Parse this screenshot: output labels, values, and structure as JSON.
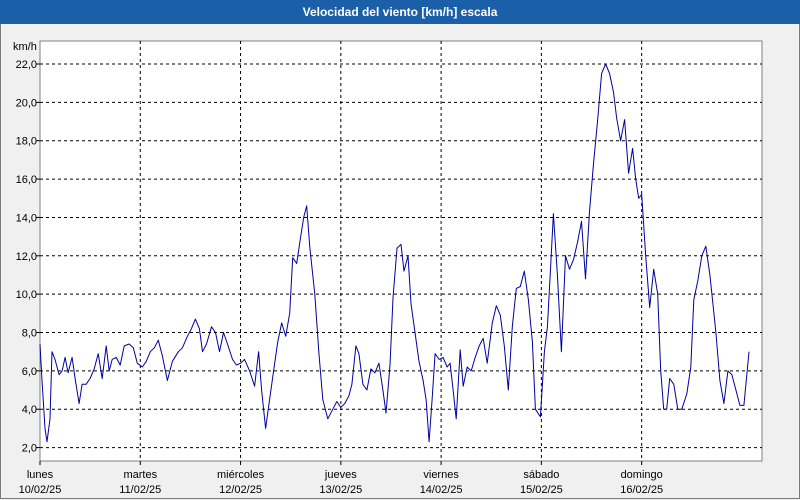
{
  "window": {
    "title": "Velocidad del viento [km/h] escala"
  },
  "colors": {
    "titlebar": "#1a5fa8",
    "line": "#0000a0",
    "plot_bg": "#ffffff",
    "background": "#f0f0f0"
  },
  "chart_data": {
    "type": "line",
    "title": "Velocidad del viento [km/h] escala",
    "ylabel": "km/h",
    "ylim": [
      1.3,
      23.2
    ],
    "yticks": [
      "2,0",
      "4,0",
      "6,0",
      "8,0",
      "10,0",
      "12,0",
      "14,0",
      "16,0",
      "18,0",
      "20,0",
      "22,0"
    ],
    "ytick_values": [
      2,
      4,
      6,
      8,
      10,
      12,
      14,
      16,
      18,
      20,
      22
    ],
    "x_range": [
      0,
      7.2
    ],
    "xticks": [
      {
        "day": "lunes",
        "date": "10/02/25",
        "pos": 0
      },
      {
        "day": "martes",
        "date": "11/02/25",
        "pos": 1
      },
      {
        "day": "miércoles",
        "date": "12/02/25",
        "pos": 2
      },
      {
        "day": "jueves",
        "date": "13/02/25",
        "pos": 3
      },
      {
        "day": "viernes",
        "date": "14/02/25",
        "pos": 4
      },
      {
        "day": "sábado",
        "date": "15/02/25",
        "pos": 5
      },
      {
        "day": "domingo",
        "date": "16/02/25",
        "pos": 6
      }
    ],
    "grid": true,
    "grid_style": "dashed",
    "series": [
      {
        "values": [
          [
            0.0,
            7.4
          ],
          [
            0.02,
            5.5
          ],
          [
            0.05,
            3.0
          ],
          [
            0.07,
            2.3
          ],
          [
            0.1,
            3.5
          ],
          [
            0.12,
            7.0
          ],
          [
            0.15,
            6.6
          ],
          [
            0.19,
            5.8
          ],
          [
            0.22,
            6.0
          ],
          [
            0.25,
            6.7
          ],
          [
            0.28,
            5.9
          ],
          [
            0.32,
            6.7
          ],
          [
            0.35,
            5.6
          ],
          [
            0.39,
            4.3
          ],
          [
            0.42,
            5.3
          ],
          [
            0.46,
            5.3
          ],
          [
            0.5,
            5.6
          ],
          [
            0.54,
            6.1
          ],
          [
            0.58,
            6.9
          ],
          [
            0.62,
            5.6
          ],
          [
            0.66,
            7.3
          ],
          [
            0.69,
            6.0
          ],
          [
            0.72,
            6.6
          ],
          [
            0.76,
            6.7
          ],
          [
            0.8,
            6.3
          ],
          [
            0.84,
            7.3
          ],
          [
            0.89,
            7.4
          ],
          [
            0.93,
            7.2
          ],
          [
            0.97,
            6.4
          ],
          [
            1.02,
            6.2
          ],
          [
            1.06,
            6.5
          ],
          [
            1.1,
            7.0
          ],
          [
            1.14,
            7.2
          ],
          [
            1.18,
            7.6
          ],
          [
            1.22,
            6.8
          ],
          [
            1.27,
            5.5
          ],
          [
            1.32,
            6.5
          ],
          [
            1.38,
            7.0
          ],
          [
            1.42,
            7.2
          ],
          [
            1.47,
            7.8
          ],
          [
            1.51,
            8.2
          ],
          [
            1.55,
            8.7
          ],
          [
            1.59,
            8.2
          ],
          [
            1.62,
            7.0
          ],
          [
            1.66,
            7.4
          ],
          [
            1.71,
            8.3
          ],
          [
            1.75,
            8.0
          ],
          [
            1.79,
            7.0
          ],
          [
            1.83,
            8.0
          ],
          [
            1.87,
            7.4
          ],
          [
            1.92,
            6.6
          ],
          [
            1.96,
            6.3
          ],
          [
            2.0,
            6.4
          ],
          [
            2.04,
            6.6
          ],
          [
            2.09,
            6.0
          ],
          [
            2.14,
            5.2
          ],
          [
            2.18,
            7.0
          ],
          [
            2.21,
            5.0
          ],
          [
            2.25,
            3.0
          ],
          [
            2.29,
            4.5
          ],
          [
            2.33,
            6.0
          ],
          [
            2.37,
            7.5
          ],
          [
            2.41,
            8.5
          ],
          [
            2.45,
            7.8
          ],
          [
            2.49,
            9.0
          ],
          [
            2.52,
            11.9
          ],
          [
            2.56,
            11.6
          ],
          [
            2.6,
            13.0
          ],
          [
            2.63,
            14.0
          ],
          [
            2.66,
            14.6
          ],
          [
            2.69,
            12.5
          ],
          [
            2.74,
            10.0
          ],
          [
            2.78,
            7.0
          ],
          [
            2.82,
            4.5
          ],
          [
            2.87,
            3.5
          ],
          [
            2.92,
            4.0
          ],
          [
            2.96,
            4.4
          ],
          [
            3.0,
            4.1
          ],
          [
            3.04,
            4.3
          ],
          [
            3.08,
            4.7
          ],
          [
            3.11,
            5.3
          ],
          [
            3.15,
            7.3
          ],
          [
            3.18,
            6.9
          ],
          [
            3.22,
            5.3
          ],
          [
            3.26,
            5.0
          ],
          [
            3.3,
            6.1
          ],
          [
            3.34,
            5.9
          ],
          [
            3.38,
            6.4
          ],
          [
            3.42,
            5.0
          ],
          [
            3.45,
            3.8
          ],
          [
            3.49,
            6.3
          ],
          [
            3.52,
            9.8
          ],
          [
            3.56,
            12.4
          ],
          [
            3.6,
            12.6
          ],
          [
            3.63,
            11.2
          ],
          [
            3.67,
            12.0
          ],
          [
            3.7,
            9.5
          ],
          [
            3.74,
            8.0
          ],
          [
            3.78,
            6.5
          ],
          [
            3.82,
            5.5
          ],
          [
            3.85,
            4.5
          ],
          [
            3.88,
            2.3
          ],
          [
            3.91,
            4.5
          ],
          [
            3.94,
            6.9
          ],
          [
            3.98,
            6.6
          ],
          [
            4.02,
            6.7
          ],
          [
            4.06,
            6.2
          ],
          [
            4.09,
            6.4
          ],
          [
            4.12,
            5.0
          ],
          [
            4.15,
            3.5
          ],
          [
            4.19,
            7.1
          ],
          [
            4.22,
            5.2
          ],
          [
            4.26,
            6.2
          ],
          [
            4.3,
            6.0
          ],
          [
            4.34,
            6.7
          ],
          [
            4.38,
            7.3
          ],
          [
            4.42,
            7.7
          ],
          [
            4.46,
            6.4
          ],
          [
            4.51,
            8.5
          ],
          [
            4.55,
            9.4
          ],
          [
            4.59,
            8.9
          ],
          [
            4.63,
            7.3
          ],
          [
            4.67,
            5.0
          ],
          [
            4.71,
            8.3
          ],
          [
            4.75,
            10.3
          ],
          [
            4.79,
            10.4
          ],
          [
            4.83,
            11.2
          ],
          [
            4.87,
            9.7
          ],
          [
            4.91,
            7.5
          ],
          [
            4.94,
            4.0
          ],
          [
            4.99,
            3.6
          ],
          [
            5.03,
            7.0
          ],
          [
            5.06,
            8.3
          ],
          [
            5.09,
            11.2
          ],
          [
            5.12,
            14.2
          ],
          [
            5.16,
            11.0
          ],
          [
            5.2,
            7.0
          ],
          [
            5.24,
            12.0
          ],
          [
            5.28,
            11.3
          ],
          [
            5.32,
            11.8
          ],
          [
            5.36,
            12.7
          ],
          [
            5.4,
            13.8
          ],
          [
            5.44,
            10.8
          ],
          [
            5.48,
            14.3
          ],
          [
            5.52,
            16.8
          ],
          [
            5.56,
            19.0
          ],
          [
            5.6,
            21.5
          ],
          [
            5.64,
            22.0
          ],
          [
            5.68,
            21.5
          ],
          [
            5.72,
            20.5
          ],
          [
            5.75,
            19.2
          ],
          [
            5.79,
            18.0
          ],
          [
            5.83,
            19.1
          ],
          [
            5.87,
            16.3
          ],
          [
            5.91,
            17.6
          ],
          [
            5.94,
            16.0
          ],
          [
            5.97,
            15.0
          ],
          [
            6.0,
            15.2
          ],
          [
            6.04,
            12.0
          ],
          [
            6.08,
            9.3
          ],
          [
            6.12,
            11.3
          ],
          [
            6.16,
            10.0
          ],
          [
            6.19,
            6.0
          ],
          [
            6.22,
            4.0
          ],
          [
            6.25,
            4.0
          ],
          [
            6.28,
            5.6
          ],
          [
            6.32,
            5.3
          ],
          [
            6.36,
            4.0
          ],
          [
            6.4,
            4.0
          ],
          [
            6.45,
            4.8
          ],
          [
            6.49,
            6.2
          ],
          [
            6.52,
            9.7
          ],
          [
            6.56,
            10.7
          ],
          [
            6.6,
            12.0
          ],
          [
            6.64,
            12.5
          ],
          [
            6.68,
            11.0
          ],
          [
            6.71,
            9.5
          ],
          [
            6.74,
            8.0
          ],
          [
            6.78,
            5.5
          ],
          [
            6.82,
            4.3
          ],
          [
            6.86,
            6.0
          ],
          [
            6.9,
            5.8
          ],
          [
            6.94,
            5.0
          ],
          [
            6.98,
            4.2
          ],
          [
            7.02,
            4.2
          ],
          [
            7.07,
            7.0
          ]
        ]
      }
    ]
  }
}
